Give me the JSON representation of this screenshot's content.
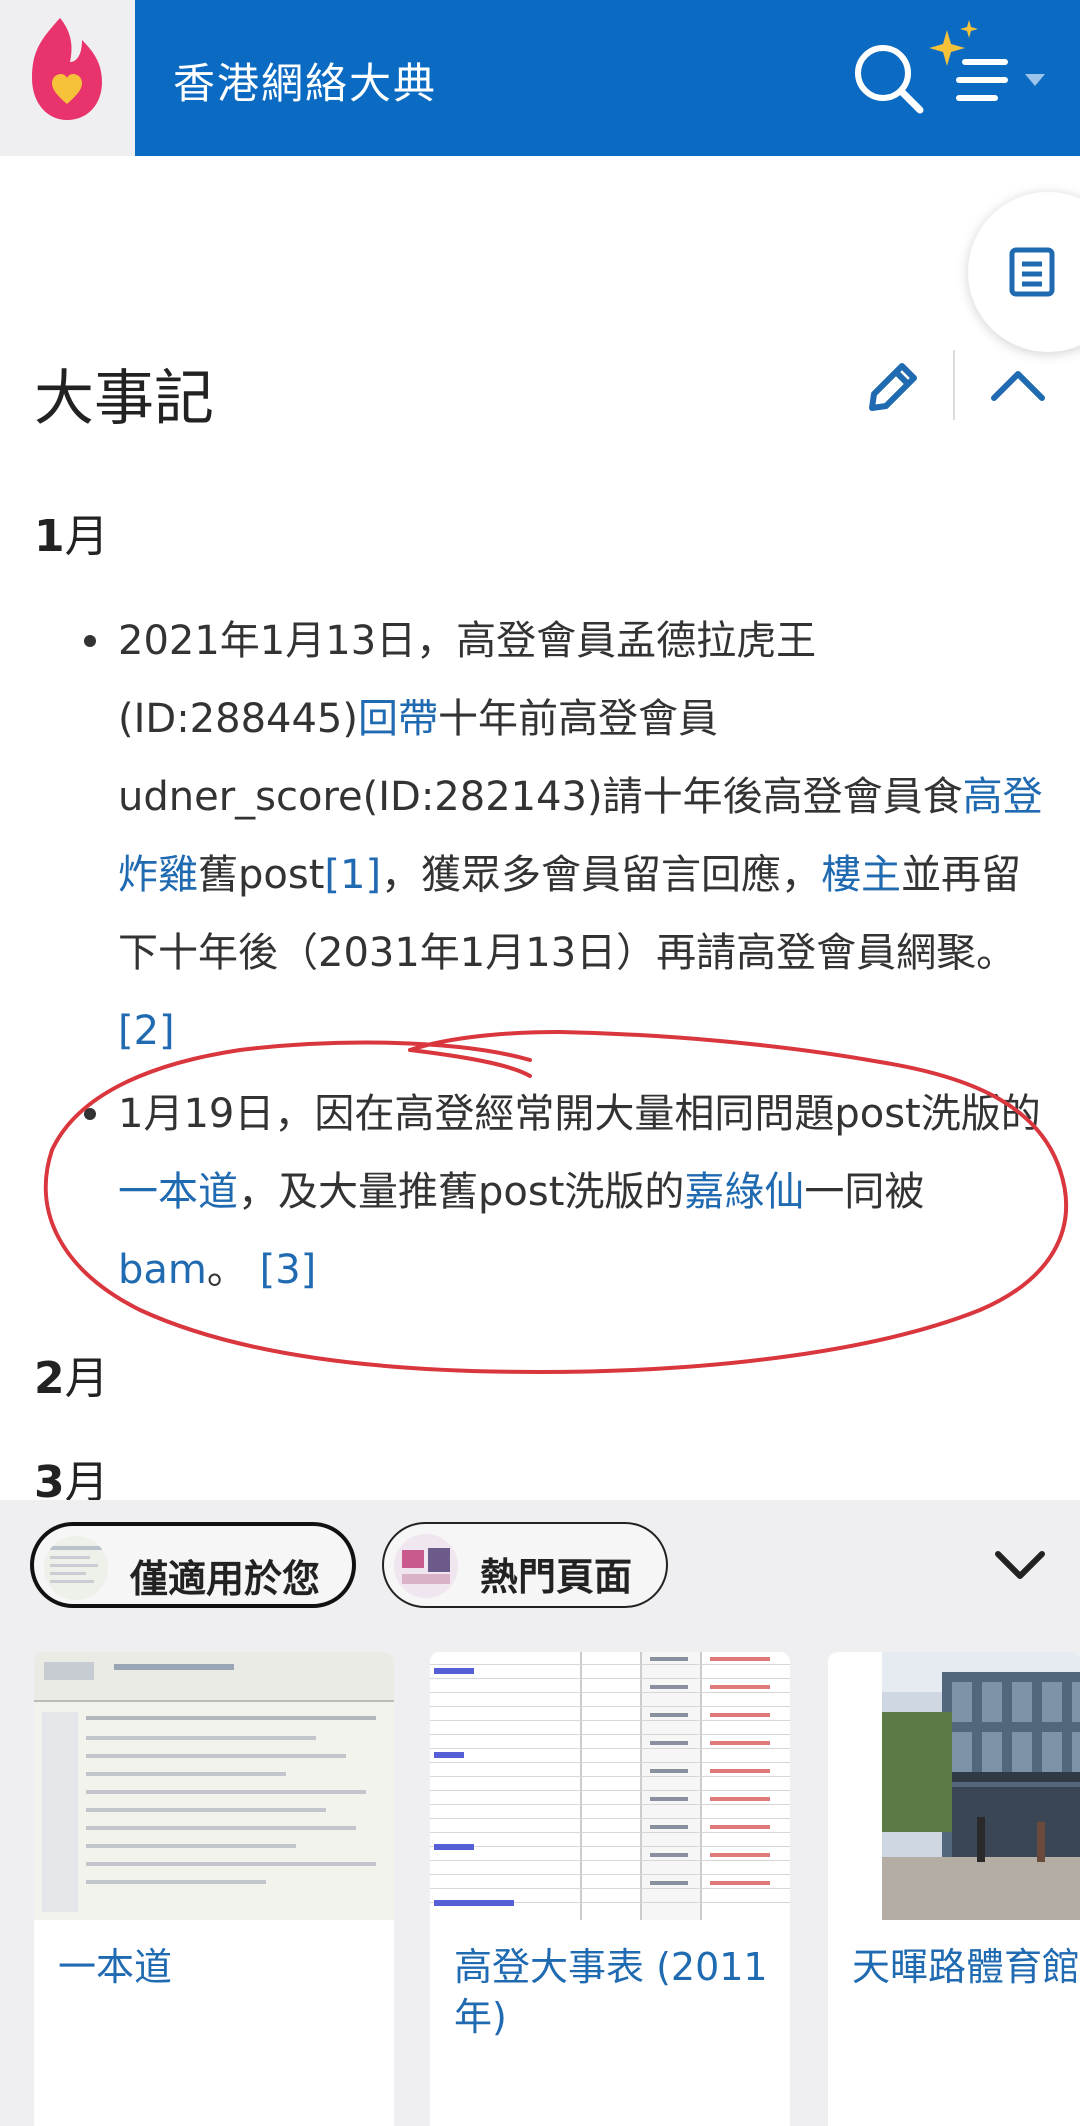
{
  "header": {
    "site_title": "香港網絡大典",
    "brand_color": "#0b6bc2"
  },
  "icons": {
    "logo": "fire-heart-logo-icon",
    "search": "search-icon",
    "menu": "sparkle-menu-icon",
    "toc": "table-of-contents-icon",
    "edit": "pencil-edit-icon",
    "collapse": "chevron-up-icon",
    "expand": "chevron-down-icon"
  },
  "section": {
    "title": "大事記"
  },
  "months": {
    "m1": "1",
    "m2": "2",
    "m3": "3",
    "suffix": "月"
  },
  "entries": {
    "e1": {
      "t1": "2021年1月13日，高登會員孟德拉虎王(ID:288445)",
      "l1": "回帶",
      "t2": "十年前高登會員udner_score(ID:282143)請十年後高登會員食",
      "l2": "高登炸雞",
      "t3": "舊post",
      "r1": "[1]",
      "t4": "，獲眾多會員留言回應，",
      "l3": "樓主",
      "t5": "並再留下十年後（2031年1月13日）再請高登會員網聚。",
      "r2": "[2]"
    },
    "e2": {
      "t1": "1月19日，因在高登經常開大量相同問題post洗版的",
      "l1": "一本道",
      "t2": "，及大量推舊post洗版的",
      "l2": "嘉綠仙",
      "t3": "一同被",
      "l3": "bam",
      "t4": "。 ",
      "r1": "[3]"
    }
  },
  "annotation_color": "#d9363e",
  "recommendations": {
    "tabs": [
      {
        "label": "僅適用於您",
        "selected": true
      },
      {
        "label": "熱門頁面",
        "selected": false
      }
    ],
    "cards": [
      {
        "title": "一本道"
      },
      {
        "title": "高登大事表 (2011年)"
      },
      {
        "title": "天暉路體育館"
      }
    ]
  }
}
